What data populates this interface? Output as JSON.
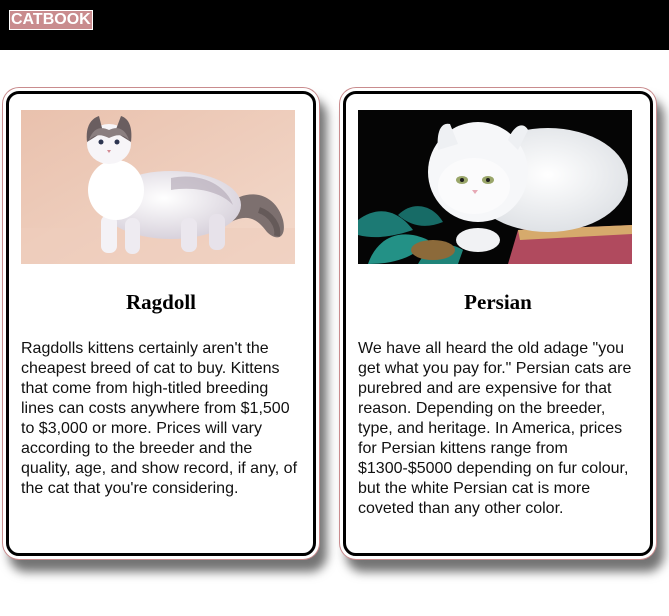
{
  "app": {
    "logo": "CATBOOK"
  },
  "cards": [
    {
      "title": "Ragdoll",
      "image": "ragdoll-cat-photo",
      "text": "Ragdolls kittens certainly aren't the cheapest breed of cat to buy. Kittens that come from high-titled breeding lines can costs anywhere from $1,500 to $3,000 or more. Prices will vary according to the breeder and the quality, age, and show record, if any, of the cat that you're considering."
    },
    {
      "title": "Persian",
      "image": "persian-cat-photo",
      "text": "We have all heard the old adage \"you get what you pay for.\" Persian cats are purebred and are expensive for that reason. Depending on the breeder, type, and heritage. In America, prices for Persian kittens range from $1300-$5000 depending on fur colour, but the white Persian cat is more coveted than any other color."
    }
  ],
  "colors": {
    "topbar": "#000000",
    "logo_bg": "#c98c8e",
    "card_border": "#000000",
    "card_outline": "#c98c8e"
  }
}
